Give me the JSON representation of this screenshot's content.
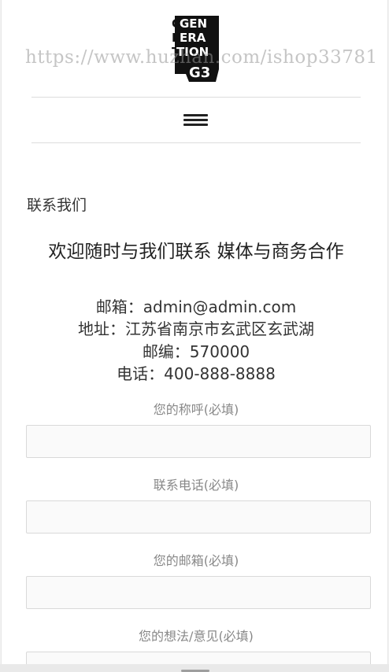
{
  "logo": {
    "text": "GENERATION G3",
    "lines": [
      "GEN",
      "ERA",
      "TION",
      "G3"
    ],
    "alt": "logo"
  },
  "watermark": {
    "text": "https://www.huzhan.com/ishop33781"
  },
  "nav": {
    "menu_icon": "hamburger-menu-icon"
  },
  "page": {
    "title": "联系我们"
  },
  "headline": "欢迎随时与我们联系 媒体与商务合作",
  "contact": {
    "email": "邮箱：admin@admin.com",
    "address": "地址：江苏省南京市玄武区玄武湖",
    "zip": "邮编：570000",
    "phone": "电话：400-888-8888"
  },
  "form": {
    "name_label": "您的称呼(必填)",
    "phone_label": "联系电话(必填)",
    "email_label": "您的邮箱(必填)",
    "message_label": "您的想法/意见(必填)",
    "name_value": "",
    "phone_value": "",
    "email_value": "",
    "message_value": ""
  },
  "colors": {
    "background": "#ffffff",
    "text": "#333333",
    "label": "#888888",
    "field_bg": "#fafafa",
    "border": "#d9d9d9"
  }
}
